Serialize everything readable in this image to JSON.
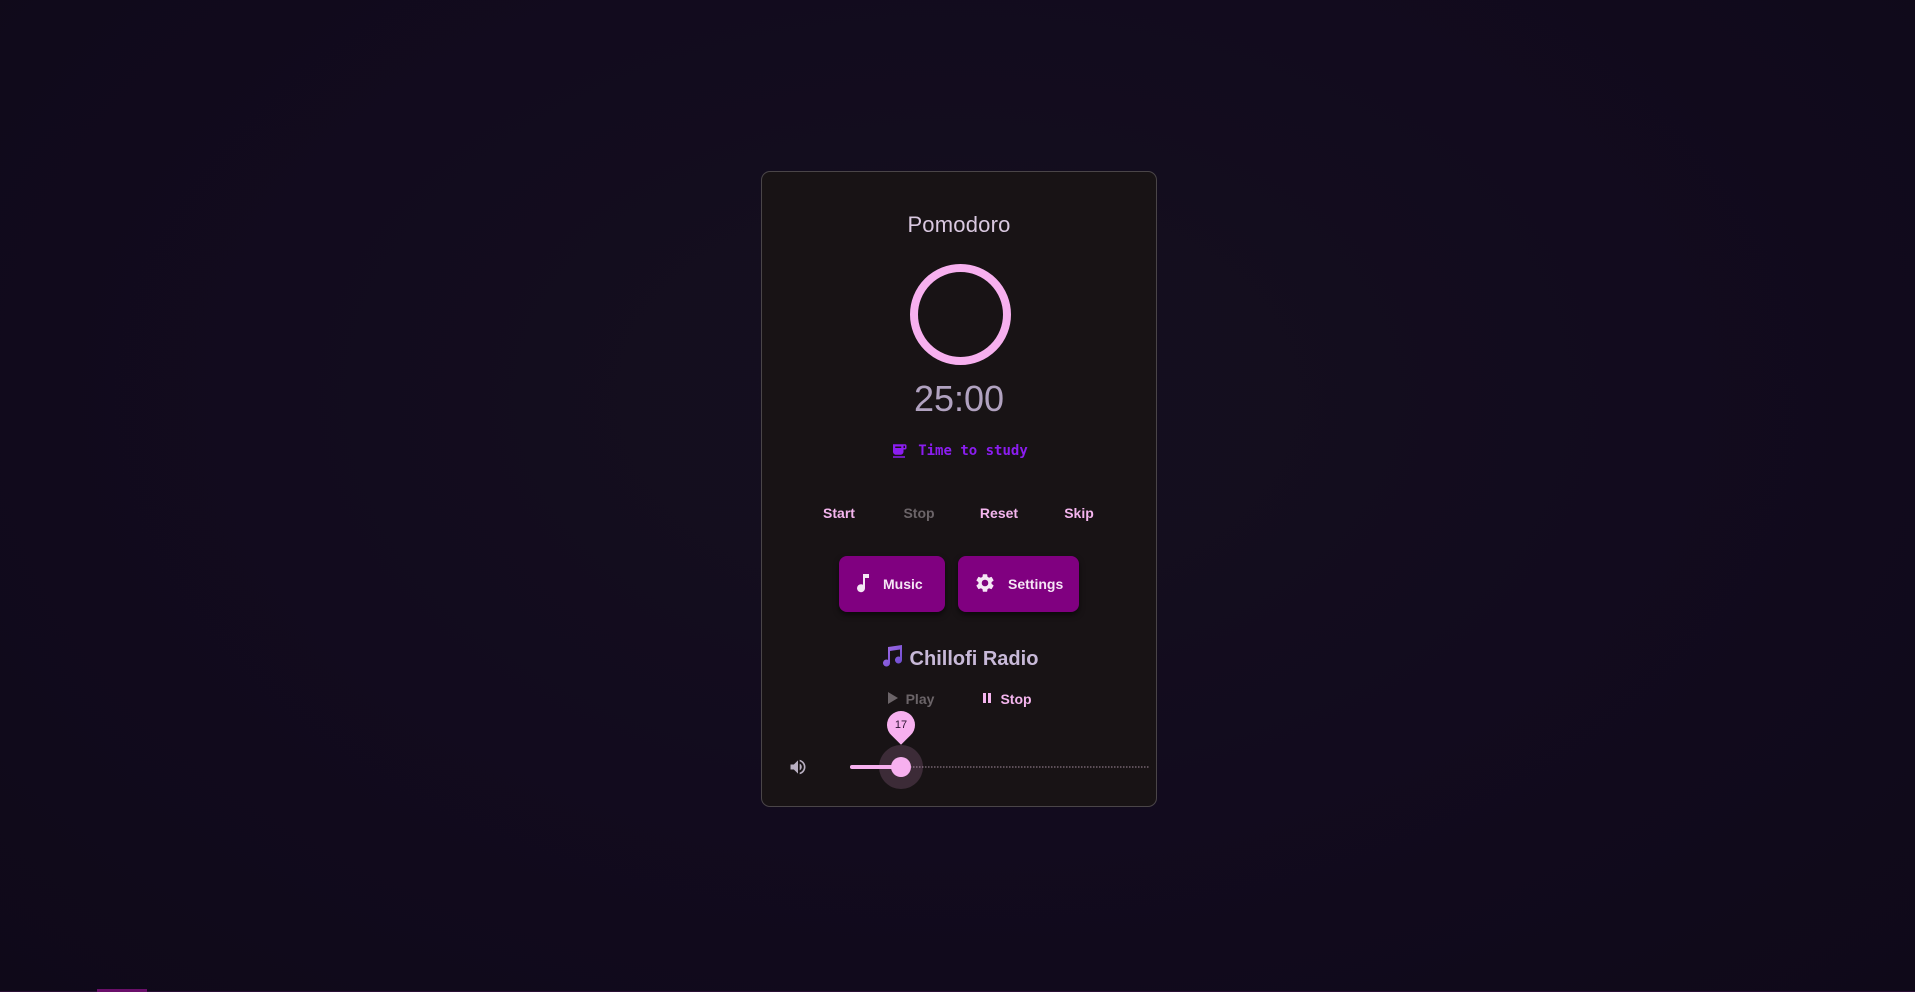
{
  "timer": {
    "title": "Pomodoro",
    "time": "25:00",
    "mode_label": "Time to study",
    "mode_icon": "coffee-icon"
  },
  "controls": {
    "start": "Start",
    "stop": "Stop",
    "reset": "Reset",
    "skip": "Skip"
  },
  "actions": {
    "music": "Music",
    "settings": "Settings"
  },
  "radio": {
    "title": "Chillofi Radio",
    "play": "Play",
    "stop": "Stop"
  },
  "volume": {
    "value": "17",
    "fraction": 0.17
  },
  "colors": {
    "accent": "#f7b0ef",
    "button": "#800080",
    "mode_text": "#8b1df0"
  }
}
